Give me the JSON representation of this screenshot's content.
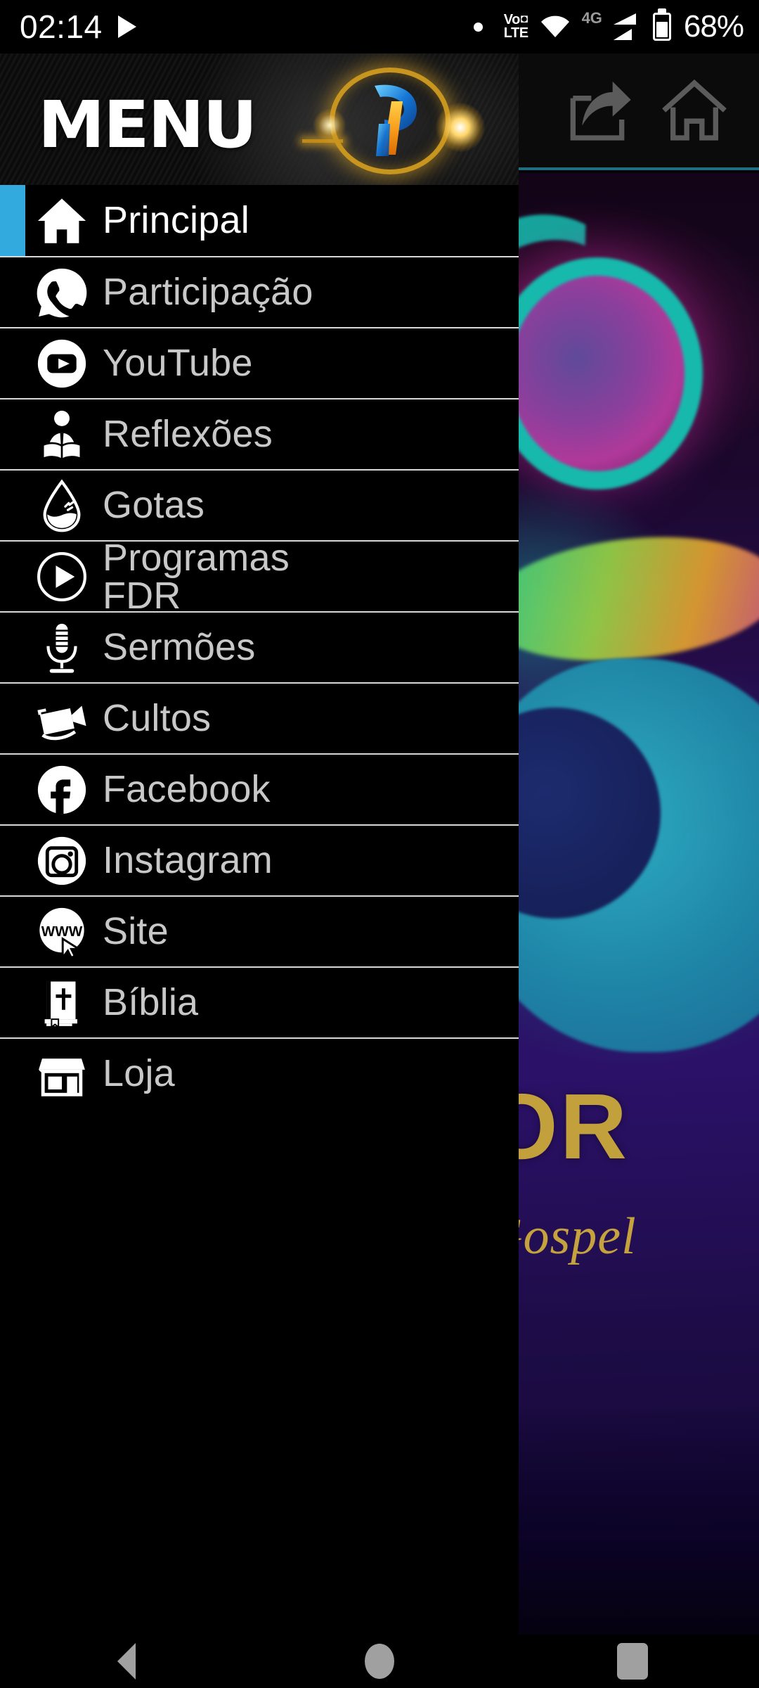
{
  "status_bar": {
    "clock": "02:14",
    "media_play_icon": "play-icon",
    "notification_dot": "dot-icon",
    "volte_vo": "Vo",
    "volte_lte": "LTE",
    "wifi_icon": "wifi-icon",
    "network_type": "4G",
    "signal_icon": "signal-bars-icon",
    "battery_icon": "battery-icon",
    "battery_text": "68%"
  },
  "background": {
    "toolbar": {
      "share_icon": "share-icon",
      "home_icon": "home-icon"
    },
    "artwork": {
      "title": "VOR",
      "subtitle": "Gospel"
    }
  },
  "drawer": {
    "header": {
      "title": "MENU",
      "logo_icon": "app-logo-icon"
    },
    "items": [
      {
        "label": "Principal",
        "icon": "home-icon",
        "selected": true
      },
      {
        "label": "Participação",
        "icon": "whatsapp-icon",
        "selected": false
      },
      {
        "label": "YouTube",
        "icon": "youtube-icon",
        "selected": false
      },
      {
        "label": "Reflexões",
        "icon": "reader-icon",
        "selected": false
      },
      {
        "label": "Gotas",
        "icon": "water-drop-icon",
        "selected": false
      },
      {
        "label": "Programas FDR",
        "icon": "play-circle-icon",
        "selected": false
      },
      {
        "label": "Sermões",
        "icon": "microphone-icon",
        "selected": false
      },
      {
        "label": "Cultos",
        "icon": "video-camera-icon",
        "selected": false
      },
      {
        "label": "Facebook",
        "icon": "facebook-icon",
        "selected": false
      },
      {
        "label": "Instagram",
        "icon": "instagram-icon",
        "selected": false
      },
      {
        "label": "Site",
        "icon": "www-cursor-icon",
        "selected": false
      },
      {
        "label": "Bíblia",
        "icon": "bible-icon",
        "selected": false
      },
      {
        "label": "Loja",
        "icon": "store-icon",
        "selected": false
      }
    ]
  },
  "nav_bar": {
    "back": "back-icon",
    "home": "home-icon",
    "recents": "recents-icon"
  },
  "colors": {
    "accent": "#33aade",
    "drawer_bg": "#000000",
    "label": "#c8c8c8",
    "label_selected": "#ffffff",
    "gold": "#c2a13c"
  }
}
